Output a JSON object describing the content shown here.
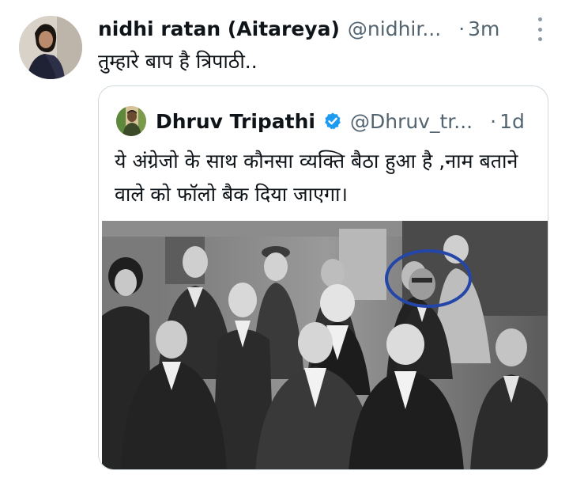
{
  "tweet": {
    "author_name": "nidhi ratan (Aitareya)",
    "handle": "@nidhir...",
    "separator": "·",
    "time": "3m",
    "text": "तुम्हारे बाप है त्रिपाठी..",
    "avatar_icon": "user-avatar",
    "more_icon": "more-vertical-icon"
  },
  "quote": {
    "author_name": "Dhruv Tripathi",
    "handle": "@Dhruv_tr...",
    "separator": "·",
    "time": "1d",
    "verified_icon": "verified-badge-icon",
    "verified_color": "#1d9bf0",
    "text": "ये अंग्रेजो के साथ कौनसा व्यक्ति बैठा हुआ है ,नाम बताने वाले को फॉलो बैक दिया जाएगा।",
    "image": "black-and-white-group-photo",
    "highlight_color": "#2446a8"
  }
}
